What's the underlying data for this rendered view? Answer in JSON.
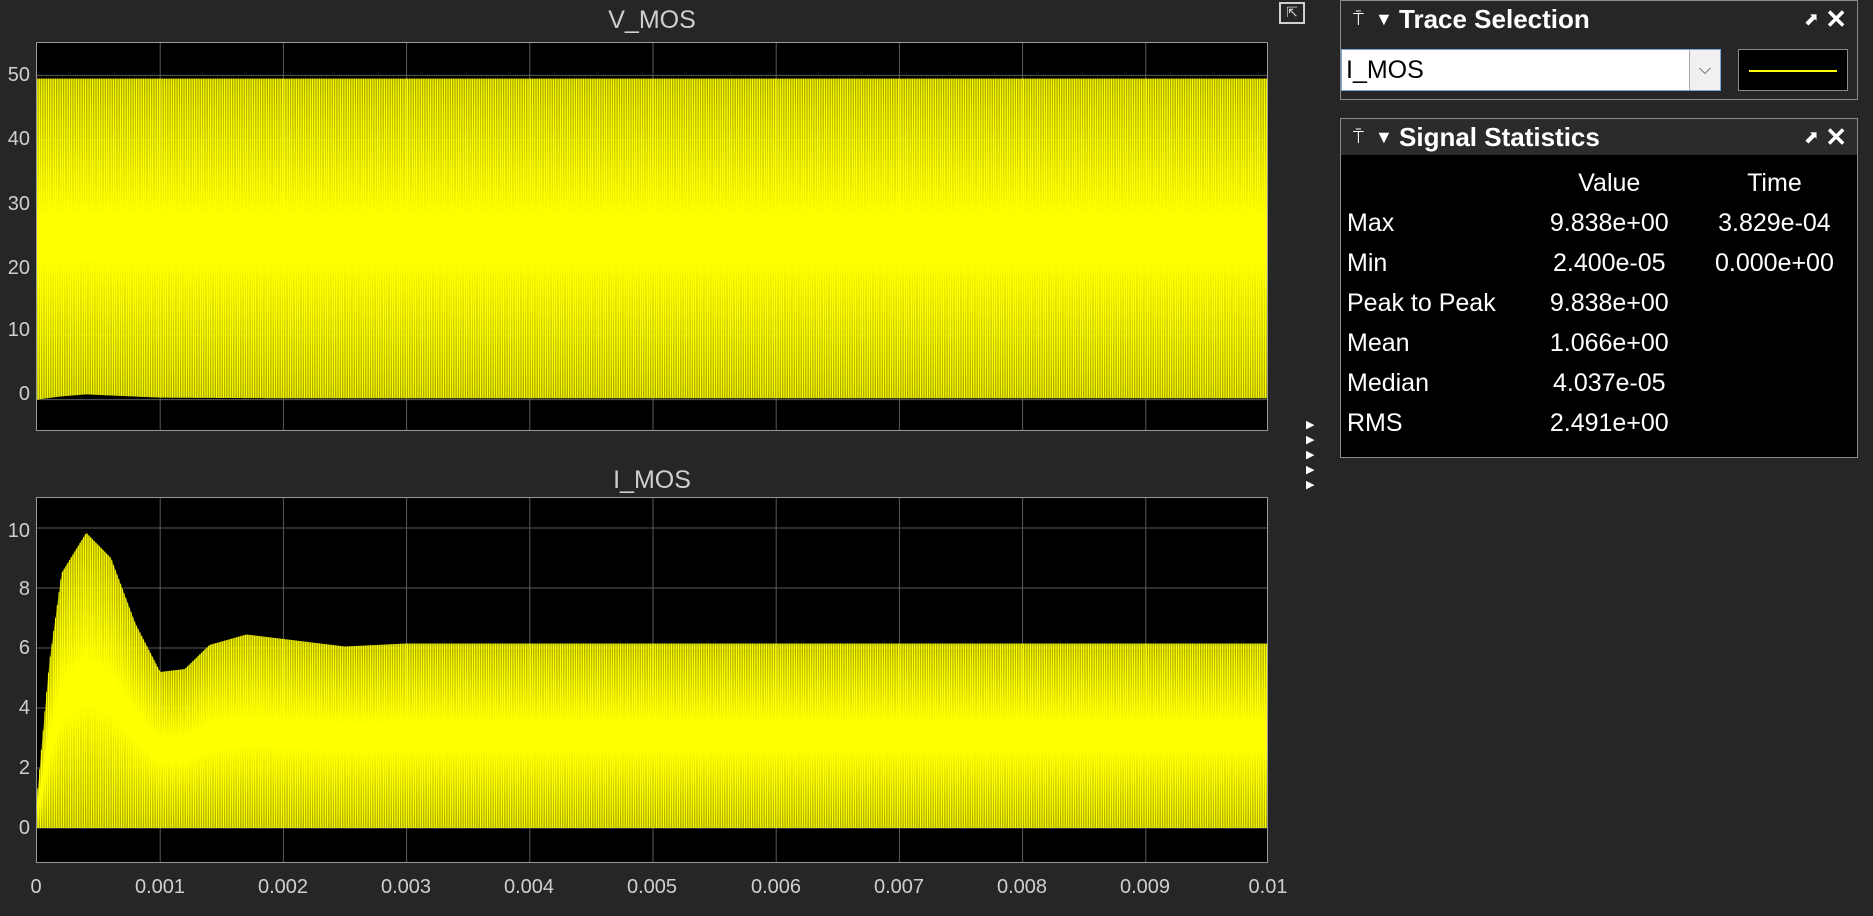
{
  "toolbar": {
    "undock_icon": "undock-icon"
  },
  "plots": [
    {
      "title": "V_MOS",
      "yticks": [
        "50",
        "40",
        "30",
        "20",
        "10",
        "0"
      ]
    },
    {
      "title": "I_MOS",
      "yticks": [
        "10",
        "8",
        "6",
        "4",
        "2",
        "0"
      ]
    }
  ],
  "xticks": [
    "0",
    "0.001",
    "0.002",
    "0.003",
    "0.004",
    "0.005",
    "0.006",
    "0.007",
    "0.008",
    "0.009",
    "0.01"
  ],
  "trace_selection": {
    "title": "Trace Selection",
    "selected": "I_MOS",
    "line_color": "#ffff00"
  },
  "signal_statistics": {
    "title": "Signal Statistics",
    "columns": [
      "",
      "Value",
      "Time"
    ],
    "rows": [
      {
        "label": "Max",
        "value": "9.838e+00",
        "time": "3.829e-04"
      },
      {
        "label": "Min",
        "value": "2.400e-05",
        "time": "0.000e+00"
      },
      {
        "label": "Peak to Peak",
        "value": "9.838e+00",
        "time": ""
      },
      {
        "label": "Mean",
        "value": "1.066e+00",
        "time": ""
      },
      {
        "label": "Median",
        "value": "4.037e-05",
        "time": ""
      },
      {
        "label": "RMS",
        "value": "2.491e+00",
        "time": ""
      }
    ]
  },
  "chart_data": [
    {
      "type": "line",
      "title": "V_MOS",
      "xlim": [
        0,
        0.01
      ],
      "ylim": [
        -5,
        55
      ],
      "grid": true,
      "series": [
        {
          "color": "#ffff00",
          "x": [
            0,
            0.0002,
            0.0004,
            0.001,
            0.002,
            0.005,
            0.01
          ],
          "y_low": [
            0,
            0.5,
            0.8,
            0.3,
            0.2,
            0.2,
            0.2
          ],
          "y_high": [
            49.5,
            49.5,
            49.5,
            49.5,
            49.5,
            49.5,
            49.5
          ]
        }
      ]
    },
    {
      "type": "line",
      "title": "I_MOS",
      "xlim": [
        0,
        0.01
      ],
      "ylim": [
        -1.2,
        11
      ],
      "grid": true,
      "series": [
        {
          "color": "#ffff00",
          "x": [
            0,
            0.0001,
            0.0002,
            0.0004,
            0.0006,
            0.0008,
            0.001,
            0.0012,
            0.0014,
            0.0017,
            0.002,
            0.0025,
            0.003,
            0.005,
            0.01
          ],
          "y_high": [
            1,
            5.5,
            8.5,
            9.84,
            9.0,
            6.8,
            5.2,
            5.3,
            6.1,
            6.45,
            6.3,
            6.05,
            6.15,
            6.15,
            6.15
          ],
          "y_low": [
            0,
            0,
            0,
            0,
            0,
            0,
            0,
            0,
            0,
            0,
            0,
            0,
            0,
            0,
            0
          ]
        }
      ]
    }
  ]
}
